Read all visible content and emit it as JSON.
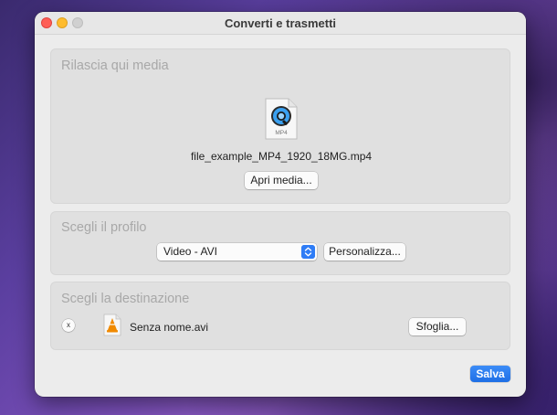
{
  "window": {
    "title": "Converti e trasmetti"
  },
  "media_panel": {
    "heading": "Rilascia qui media",
    "file_icon_label": "MP4",
    "filename": "file_example_MP4_1920_18MG.mp4",
    "open_button_label": "Apri media..."
  },
  "profile_panel": {
    "heading": "Scegli il profilo",
    "selected_profile": "Video - AVI",
    "customize_button_label": "Personalizza..."
  },
  "destination_panel": {
    "heading": "Scegli la destinazione",
    "clear_button_label": "x",
    "destination_filename": "Senza nome.avi",
    "browse_button_label": "Sfoglia..."
  },
  "footer": {
    "save_button_label": "Salva"
  },
  "colors": {
    "accent": "#2e7cf6",
    "window_bg": "#ececec",
    "panel_bg": "#e0e0e0",
    "heading_text": "#a8a8a8",
    "vlc_orange": "#f08a00"
  }
}
